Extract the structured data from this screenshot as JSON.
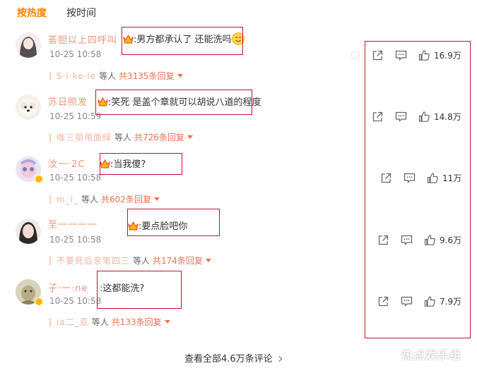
{
  "tabs": [
    {
      "label": "按热度",
      "active": true
    },
    {
      "label": "按时间",
      "active": false
    }
  ],
  "comments": [
    {
      "user": "荟胆以上四呼叫",
      "text": "男方都承认了 还能洗吗",
      "has_emoji": true,
      "time": "10-25 10:58",
      "reply_user": "S·i·ke·ie",
      "reply_prefix": "等人",
      "reply_count": "共3135条回复",
      "likes": "16.9万"
    },
    {
      "user": "苏日照发",
      "text": "笑死 是盖个章就可以胡说八道的程度",
      "has_emoji": false,
      "time": "10-25 10:59",
      "reply_user": "咖三丽用面绿",
      "reply_prefix": "等人",
      "reply_count": "共726条回复",
      "likes": "14.8万"
    },
    {
      "user": "汝一·2C",
      "text": "当我傻?",
      "has_emoji": false,
      "time": "10-25 10:58",
      "reply_user": "m_i_",
      "reply_prefix": "等人",
      "reply_count": "共602条回复",
      "likes": "11万"
    },
    {
      "user": "至一一一一",
      "text": "要点脸吧你",
      "has_emoji": false,
      "time": "10-25 10:58",
      "reply_user": "不要死后亲笔四三",
      "reply_prefix": "等人",
      "reply_count": "共174条回复",
      "likes": "9.6万"
    },
    {
      "user": "子·一·ne",
      "text": "这都能洗?",
      "has_emoji": false,
      "time": "10-25 10:58",
      "reply_user": "ia二_亚",
      "reply_prefix": "等人",
      "reply_count": "共133条回复",
      "likes": "7.9万"
    }
  ],
  "footer": {
    "more_label": "查看全部4.6万条评论"
  },
  "watermark": "热点娱乐组",
  "icons": [
    "share-icon",
    "comment-icon",
    "like-icon",
    "crown-icon",
    "caret-down-icon",
    "chevron-right-icon"
  ],
  "colors": {
    "accent": "#ff8200",
    "reply_link": "#eb7350",
    "highlight_box": "#c8102e"
  }
}
